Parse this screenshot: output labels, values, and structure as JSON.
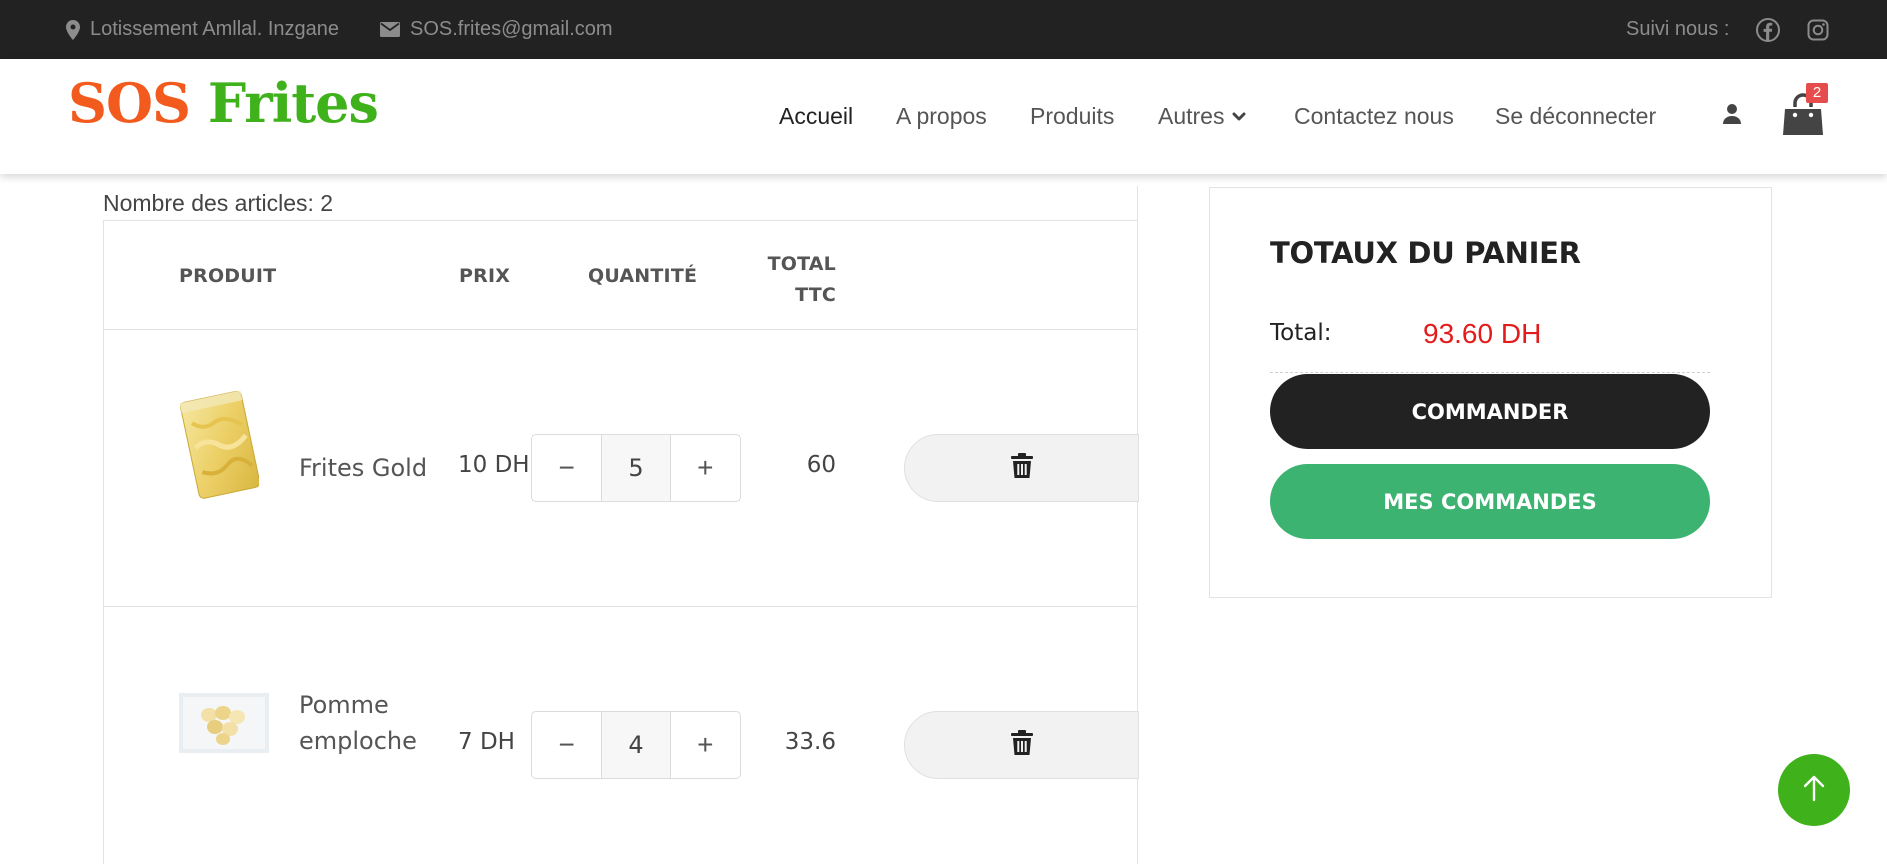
{
  "topbar": {
    "address": "Lotissement Amllal. Inzgane",
    "email": "SOS.frites@gmail.com",
    "follow_label": "Suivi nous :",
    "icons": [
      "map-marker-icon",
      "envelope-icon",
      "facebook-icon",
      "instagram-icon"
    ]
  },
  "header": {
    "logo_part1": "SOS",
    "logo_part2": "Frites",
    "nav": [
      {
        "label": "Accueil",
        "active": true
      },
      {
        "label": "A propos"
      },
      {
        "label": "Produits"
      },
      {
        "label": "Autres"
      },
      {
        "label": "Contactez nous"
      },
      {
        "label": "Se déconnecter"
      }
    ],
    "cart_count": "2"
  },
  "cart": {
    "count_text": "Nombre des articles: 2",
    "headers": {
      "product": "PRODUIT",
      "price": "PRIX",
      "quantity": "QUANTITÉ",
      "total_line1": "TOTAL",
      "total_line2": "TTC"
    },
    "items": [
      {
        "name": "Frites Gold",
        "price": "10 DH",
        "quantity": "5",
        "total": "60",
        "minus": "−",
        "plus": "+"
      },
      {
        "name_line1": "Pomme",
        "name_line2": "emploche",
        "price": "7 DH",
        "quantity": "4",
        "total": "33.6",
        "minus": "−",
        "plus": "+"
      }
    ]
  },
  "totals": {
    "title": "TOTAUX DU PANIER",
    "total_label": "Total:",
    "total_value": "93.60 DH",
    "order_button": "COMMANDER",
    "my_orders_button": "MES COMMANDES"
  },
  "colors": {
    "logo_orange": "#f25a1e",
    "logo_green": "#3fb11a",
    "topbar_bg": "#222222",
    "total_red": "#e41b1b",
    "orders_green": "#3cb371",
    "scroll_top_green": "#3fb11a"
  }
}
